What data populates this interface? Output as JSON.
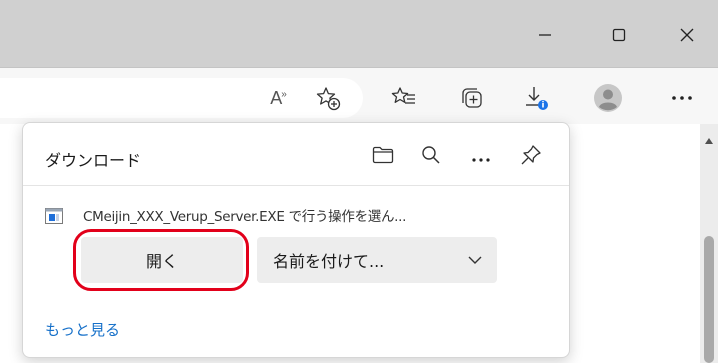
{
  "window": {
    "minimize_icon": "minimize-icon",
    "maximize_icon": "maximize-icon",
    "close_icon": "close-icon"
  },
  "toolbar": {
    "read_aloud_glyph": "A",
    "read_aloud_sup": "»",
    "icons": [
      "read-aloud-icon",
      "add-favorite-icon",
      "favorites-icon",
      "collections-icon",
      "downloads-icon",
      "profile-icon",
      "more-icon"
    ]
  },
  "downloads": {
    "title": "ダウンロード",
    "header_icons": [
      "folder-icon",
      "search-icon",
      "more-options-icon",
      "pin-icon"
    ],
    "file_name": "CMeijin_XXX_Verup_Server.EXE で行う操作を選ん...",
    "open_label": "開く",
    "save_as_label": "名前を付けて...",
    "see_more_label": "もっと見る"
  },
  "colors": {
    "highlight": "#e2001a",
    "link": "#1670c9",
    "badge": "#1a73e8"
  }
}
